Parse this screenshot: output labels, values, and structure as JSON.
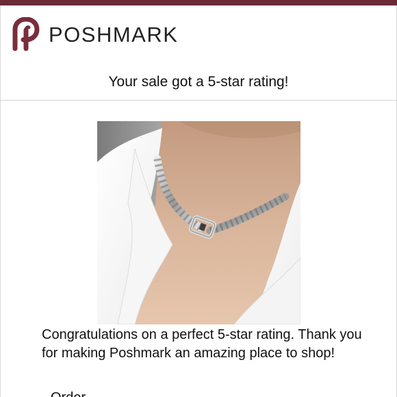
{
  "header": {
    "brand_name": "POSHMARK",
    "logo_icon": "poshmark-p-logo-icon",
    "accent_color": "#7a2d3c"
  },
  "notification": {
    "headline": "Your sale got a 5-star rating!"
  },
  "product": {
    "image_description_icon": "silver-chain-necklace-photo"
  },
  "message": {
    "body": "Congratulations on a perfect 5-star rating. Thank you for making Poshmark an amazing place to shop!",
    "next_section_partial": "Order"
  }
}
